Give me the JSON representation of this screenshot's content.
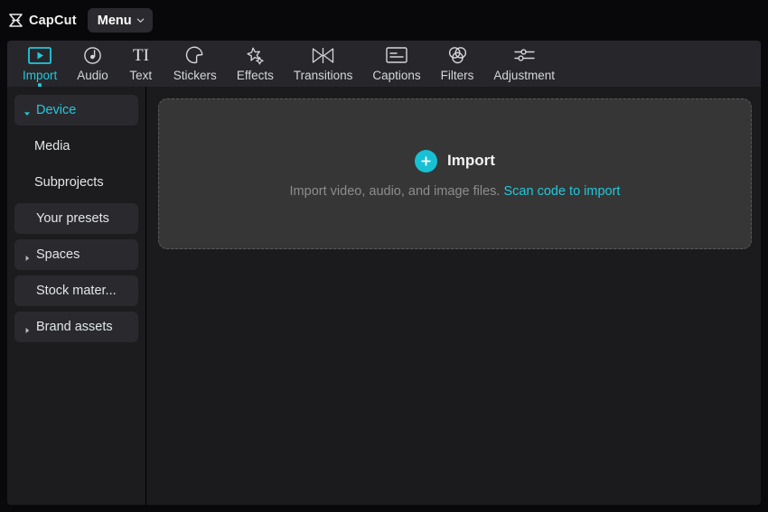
{
  "app": {
    "brand_name": "CapCut",
    "logo_icon": "capcut-hourglass-logo",
    "menu_label": "Menu",
    "menu_caret_icon": "chevron-down-icon"
  },
  "colors": {
    "accent": "#22c8dc",
    "plus_button": "#18c0d4",
    "titlebar_bg": "#08080a",
    "tabbar_bg": "#27272b",
    "sidebar_bg": "#1c1c1e",
    "content_bg": "#1b1b1d",
    "dropzone_bg": "#363636",
    "dropzone_border": "#5a5a5a",
    "text_primary": "#e3e5e8",
    "text_muted": "#8d8d8f"
  },
  "tabs": [
    {
      "label": "Import",
      "icon": "import-play-icon",
      "active": true
    },
    {
      "label": "Audio",
      "icon": "music-note-icon",
      "active": false
    },
    {
      "label": "Text",
      "icon": "text-ti-icon",
      "active": false
    },
    {
      "label": "Stickers",
      "icon": "sticker-pie-icon",
      "active": false
    },
    {
      "label": "Effects",
      "icon": "star-sparkle-icon",
      "active": false
    },
    {
      "label": "Transitions",
      "icon": "transition-bowtie-icon",
      "active": false
    },
    {
      "label": "Captions",
      "icon": "captions-box-icon",
      "active": false
    },
    {
      "label": "Filters",
      "icon": "filters-circles-icon",
      "active": false
    },
    {
      "label": "Adjustment",
      "icon": "adjustment-sliders-icon",
      "active": false
    }
  ],
  "sidebar": {
    "items": [
      {
        "label": "Device",
        "caret": "caret-down-icon",
        "style": "pill",
        "active": true
      },
      {
        "label": "Media",
        "caret": "none",
        "style": "sub",
        "active": false
      },
      {
        "label": "Subprojects",
        "caret": "none",
        "style": "sub",
        "active": false
      },
      {
        "label": "Your presets",
        "caret": "none",
        "style": "pill",
        "active": false
      },
      {
        "label": "Spaces",
        "caret": "caret-right-icon",
        "style": "pill",
        "active": false
      },
      {
        "label": "Stock mater...",
        "caret": "none",
        "style": "pill",
        "active": false
      },
      {
        "label": "Brand assets",
        "caret": "caret-right-icon",
        "style": "pill",
        "active": false
      }
    ]
  },
  "dropzone": {
    "title": "Import",
    "plus_icon": "plus-circle-icon",
    "hint_text": "Import video, audio, and image files.",
    "link_text": "Scan code to import"
  }
}
